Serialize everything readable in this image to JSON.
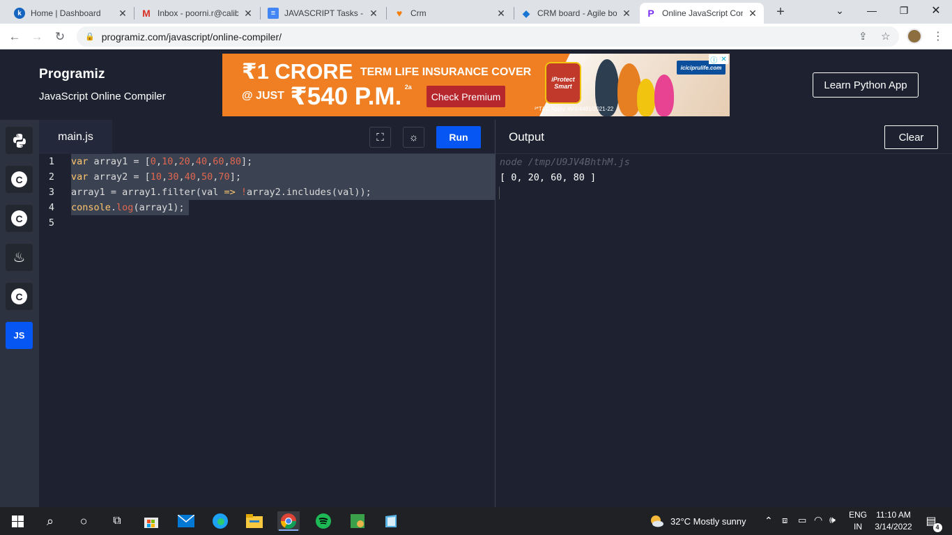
{
  "browser": {
    "tabs": [
      {
        "title": "Home | Dashboard",
        "favicon": "k"
      },
      {
        "title": "Inbox - poorni.r@calib",
        "favicon": "M"
      },
      {
        "title": "JAVASCRIPT Tasks - Po",
        "favicon": "≡"
      },
      {
        "title": "Crm",
        "favicon": "♥"
      },
      {
        "title": "CRM board - Agile bo",
        "favicon": "◆"
      },
      {
        "title": "Online JavaScript Com",
        "favicon": "P"
      }
    ],
    "new_tab": "+",
    "url": "programiz.com/javascript/online-compiler/"
  },
  "site": {
    "logo": "Programiz",
    "subtitle": "JavaScript Online Compiler",
    "learn_button": "Learn Python App"
  },
  "ad": {
    "headline_big": "₹1 CRORE",
    "headline_small": "TERM LIFE INSURANCE COVER",
    "price_prefix": "@ JUST",
    "price": "₹540 P.M.",
    "price_sup": "2a",
    "cta": "Check Premium",
    "badge": "iProtect Smart",
    "brand": "iciciprulife.com",
    "terms": "²*T&C Apply. W/II/4481/2021-22"
  },
  "sidebar": {
    "languages": [
      {
        "name": "python"
      },
      {
        "name": "c",
        "glyph": "C"
      },
      {
        "name": "cpp",
        "glyph": "C"
      },
      {
        "name": "java",
        "glyph": "♨"
      },
      {
        "name": "csharp",
        "glyph": "C"
      },
      {
        "name": "javascript",
        "glyph": "JS"
      }
    ]
  },
  "editor": {
    "file_tab": "main.js",
    "run_label": "Run",
    "line_numbers": [
      "1",
      "2",
      "3",
      "4",
      "5"
    ],
    "lines": [
      "var array1 = [0,10,20,40,60,80];",
      "var array2 = [10,30,40,50,70];",
      "array1 = array1.filter(val => !array2.includes(val));",
      "console.log(array1);",
      ""
    ]
  },
  "output": {
    "title": "Output",
    "clear_label": "Clear",
    "command": "node /tmp/U9JV4BhthM.js",
    "result": "[ 0, 20, 60, 80 ]"
  },
  "taskbar": {
    "weather": "32°C  Mostly sunny",
    "lang_top": "ENG",
    "lang_bottom": "IN",
    "time": "11:10 AM",
    "date": "3/14/2022",
    "notifications": "4"
  }
}
